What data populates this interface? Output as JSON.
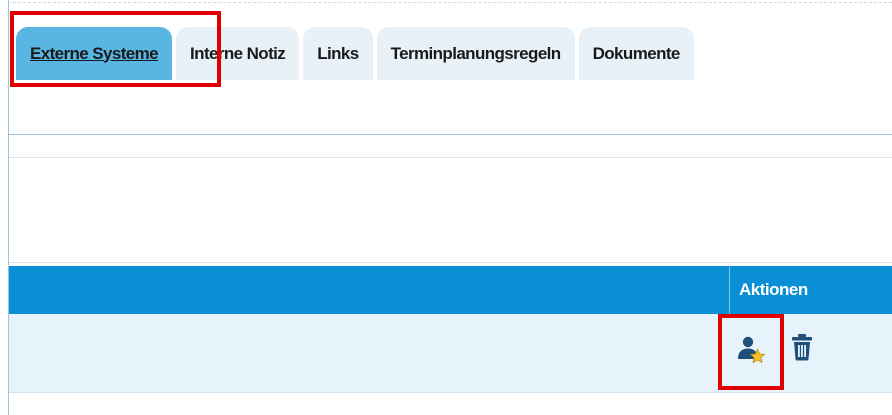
{
  "tabs": [
    {
      "label": "Externe Systeme",
      "active": true
    },
    {
      "label": "Interne Notiz",
      "active": false
    },
    {
      "label": "Links",
      "active": false
    },
    {
      "label": "Terminplanungsregeln",
      "active": false
    },
    {
      "label": "Dokumente",
      "active": false
    }
  ],
  "table": {
    "columns": [
      "",
      "Aktionen"
    ],
    "row_actions": [
      "user-star-icon",
      "trash-icon"
    ]
  },
  "colors": {
    "active_tab": "#59b6e3",
    "inactive_tab": "#e8f1f7",
    "header": "#0a8fd4",
    "row": "#e7f3fb",
    "highlight": "#e00000"
  }
}
